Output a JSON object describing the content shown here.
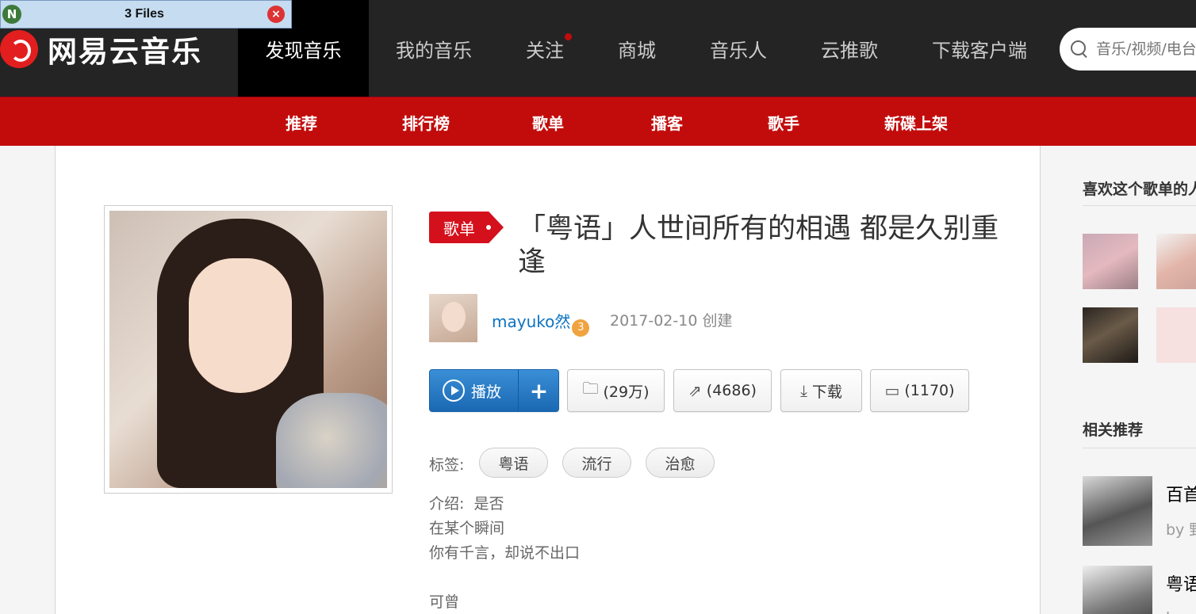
{
  "filebar": {
    "icon": "N",
    "title": "3 Files",
    "close": "×"
  },
  "header": {
    "logo_text": "网易云音乐",
    "nav": [
      "发现音乐",
      "我的音乐",
      "关注",
      "商城",
      "音乐人",
      "云推歌",
      "下载客户端"
    ],
    "search_placeholder": "音乐/视频/电台/用户"
  },
  "subnav": [
    "推荐",
    "排行榜",
    "歌单",
    "播客",
    "歌手",
    "新碟上架"
  ],
  "playlist": {
    "badge": "歌单",
    "title": "「粤语」人世间所有的相遇 都是久别重逢",
    "creator": "mayuko然",
    "creator_level": "3",
    "created": "2017-02-10 创建",
    "buttons": {
      "play": "播放",
      "add": "+",
      "favorite": "(29万)",
      "share": "(4686)",
      "download": "下载",
      "comment": "(1170)"
    },
    "tags_label": "标签:",
    "tags": [
      "粤语",
      "流行",
      "治愈"
    ],
    "intro_lines": [
      "介绍:  是否",
      "在某个瞬间",
      "你有千言，却说不出口",
      "",
      "可曾"
    ]
  },
  "sidebar": {
    "likers_heading": "喜欢这个歌单的人",
    "related_heading": "相关推荐",
    "related": [
      {
        "title": "百首",
        "by": "by 野"
      },
      {
        "title": "粤语",
        "by": "by 小"
      }
    ]
  },
  "colors": {
    "brand_red": "#c20c0c",
    "header_bg": "#242424",
    "link_blue": "#0c73c2",
    "play_blue": "#1a68b3"
  }
}
